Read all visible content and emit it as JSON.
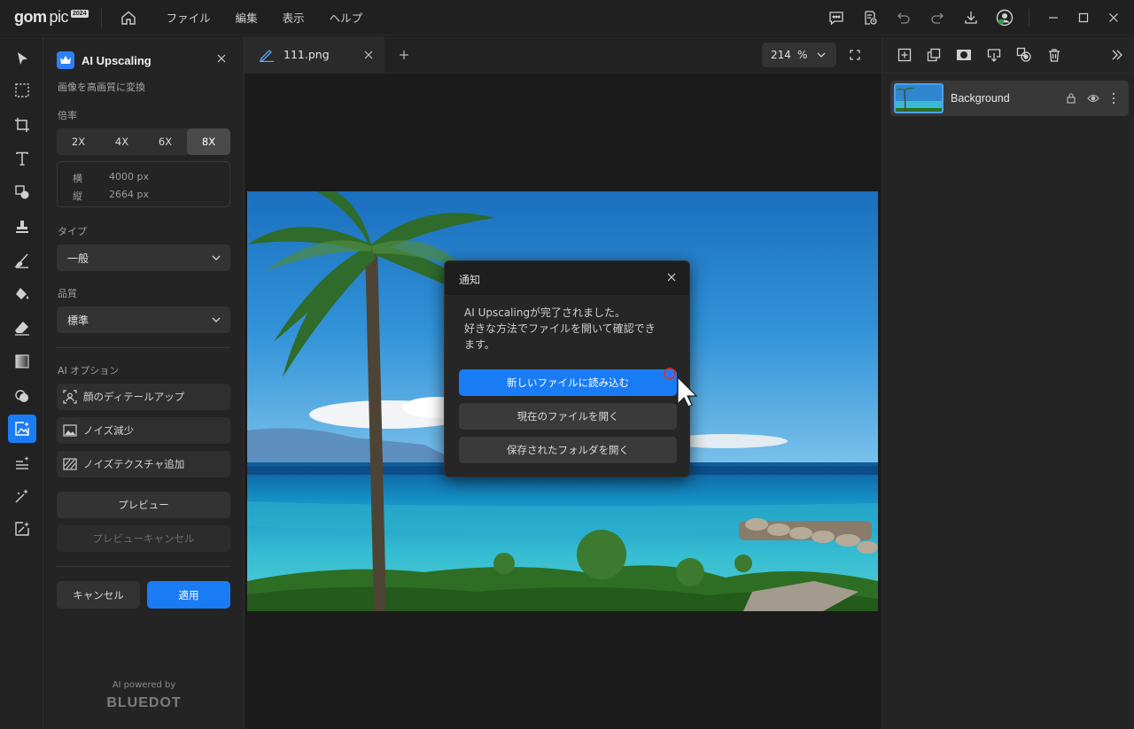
{
  "app": {
    "logo_main": "gom",
    "logo_sub": "pic",
    "logo_badge": "2024",
    "menu": [
      "ファイル",
      "編集",
      "表示",
      "ヘルプ"
    ]
  },
  "panel": {
    "title": "AI Upscaling",
    "subtitle": "画像を高画質に変換",
    "scale_label": "倍率",
    "scales": [
      "2X",
      "4X",
      "6X",
      "8X"
    ],
    "selected_scale": "8X",
    "width_label": "横",
    "width_value": "4000 px",
    "height_label": "縦",
    "height_value": "2664 px",
    "type_label": "タイプ",
    "type_value": "一般",
    "quality_label": "品質",
    "quality_value": "標準",
    "ai_options_label": "AI オプション",
    "options": [
      "顔のディテールアップ",
      "ノイズ減少",
      "ノイズテクスチャ追加"
    ],
    "preview_label": "プレビュー",
    "preview_cancel_label": "プレビューキャンセル",
    "cancel_label": "キャンセル",
    "apply_label": "適用",
    "powered_by": "AI powered by",
    "brand": "BLUEDOT"
  },
  "tabs": {
    "file_name": "111.png",
    "zoom_value": "214",
    "zoom_unit": "%"
  },
  "dialog": {
    "title": "通知",
    "message_line1": "AI Upscalingが完了されました。",
    "message_line2": "好きな方法でファイルを開いて確認でき",
    "message_line3": "ます。",
    "btn_new": "新しいファイルに読み込む",
    "btn_open_current": "現在のファイルを開く",
    "btn_open_folder": "保存されたフォルダを開く"
  },
  "layers": {
    "items": [
      {
        "name": "Background"
      }
    ]
  },
  "colors": {
    "accent": "#1a7cf5",
    "background": "#1c1c1c",
    "panel": "#242424"
  }
}
